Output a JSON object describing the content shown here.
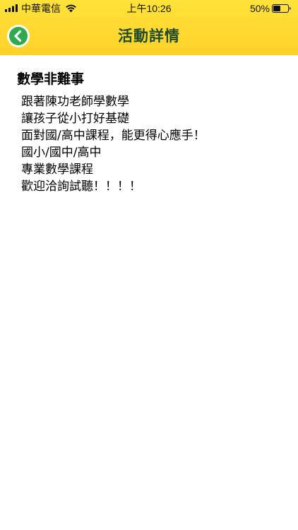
{
  "status_bar": {
    "carrier": "中華電信",
    "time": "上午10:26",
    "battery": "50%",
    "battery_level": 0.5
  },
  "nav": {
    "title": "活動詳情",
    "back_icon": "chevron-left-icon",
    "accent_color": "#2faa4e",
    "bar_color": "#ffd82e"
  },
  "event": {
    "title": "數學非難事",
    "lines": [
      "跟著陳功老師學數學",
      "讓孩子從小打好基礎",
      "面對國/高中課程，能更得心應手！",
      "國小/國中/高中",
      "專業數學課程",
      "歡迎洽詢試聽！！！！"
    ]
  }
}
